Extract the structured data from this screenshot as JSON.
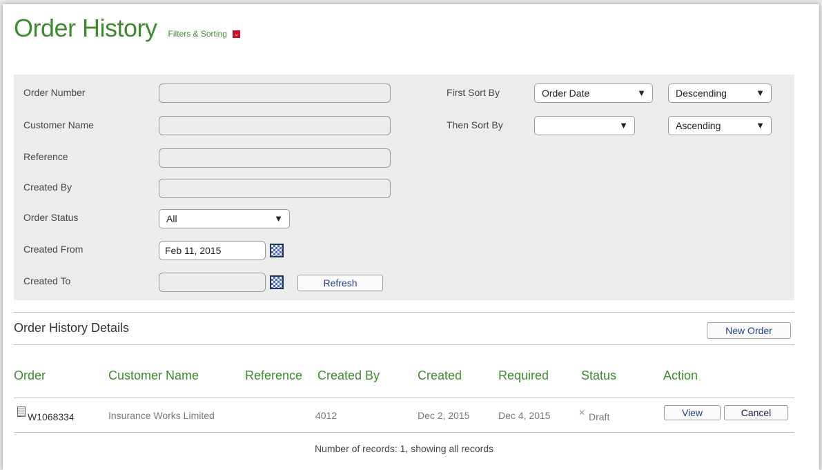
{
  "header": {
    "title": "Order History",
    "filters_link": "Filters & Sorting"
  },
  "filters": {
    "order_number": {
      "label": "Order Number",
      "value": ""
    },
    "customer_name": {
      "label": "Customer Name",
      "value": ""
    },
    "reference": {
      "label": "Reference",
      "value": ""
    },
    "created_by": {
      "label": "Created By",
      "value": ""
    },
    "order_status": {
      "label": "Order Status",
      "value": "All"
    },
    "created_from": {
      "label": "Created From",
      "value": "Feb 11, 2015"
    },
    "created_to": {
      "label": "Created To",
      "value": ""
    },
    "refresh_label": "Refresh"
  },
  "sorting": {
    "first_label": "First Sort By",
    "first_field": "Order Date",
    "first_dir": "Descending",
    "then_label": "Then Sort By",
    "then_field": "",
    "then_dir": "Ascending"
  },
  "details": {
    "title": "Order History Details",
    "new_order_label": "New Order",
    "columns": [
      "Order",
      "Customer Name",
      "Reference",
      "Created By",
      "Created",
      "Required",
      "Status",
      "Action"
    ],
    "rows": [
      {
        "order": "W1068334",
        "customer": "Insurance Works Limited",
        "reference": "",
        "created_by": "4012",
        "created": "Dec 2, 2015",
        "required": "Dec 4, 2015",
        "status": "Draft",
        "view_label": "View",
        "cancel_label": "Cancel"
      }
    ],
    "footer": "Number of records: 1, showing all records"
  },
  "colors": {
    "title_green": "#3e8a2e",
    "panel_bg": "#ececec",
    "toggle_red": "#c8102e",
    "button_text": "#1f3f8a"
  },
  "icons": {
    "filter_toggle": "chevron-down-icon",
    "calendar": "calendar-icon",
    "order_doc": "document-icon",
    "status_draft": "close-icon"
  }
}
